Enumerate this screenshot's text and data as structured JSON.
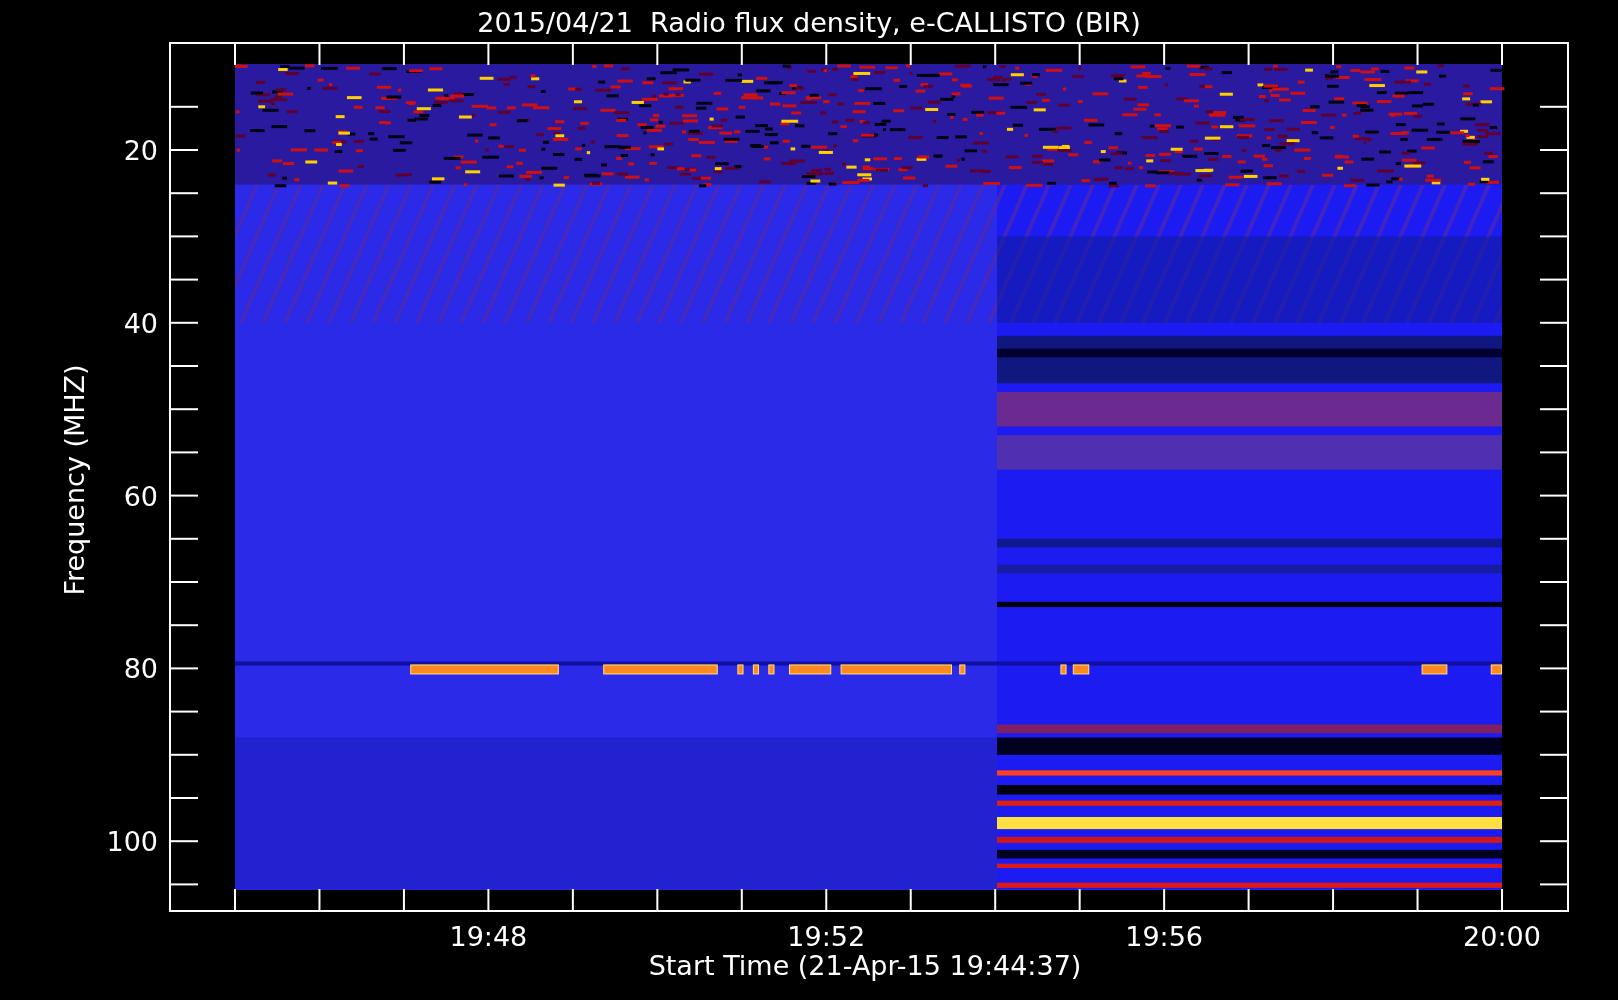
{
  "title": "2015/04/21  Radio flux density, e-CALLISTO (BIR)",
  "y_axis": {
    "label": "Frequency (MHZ)",
    "ticks": [
      "20",
      "40",
      "60",
      "80",
      "100"
    ]
  },
  "x_axis": {
    "label": "Start Time (21-Apr-15 19:44:37)",
    "ticks": [
      "19:48",
      "19:52",
      "19:56",
      "20:00"
    ]
  }
}
